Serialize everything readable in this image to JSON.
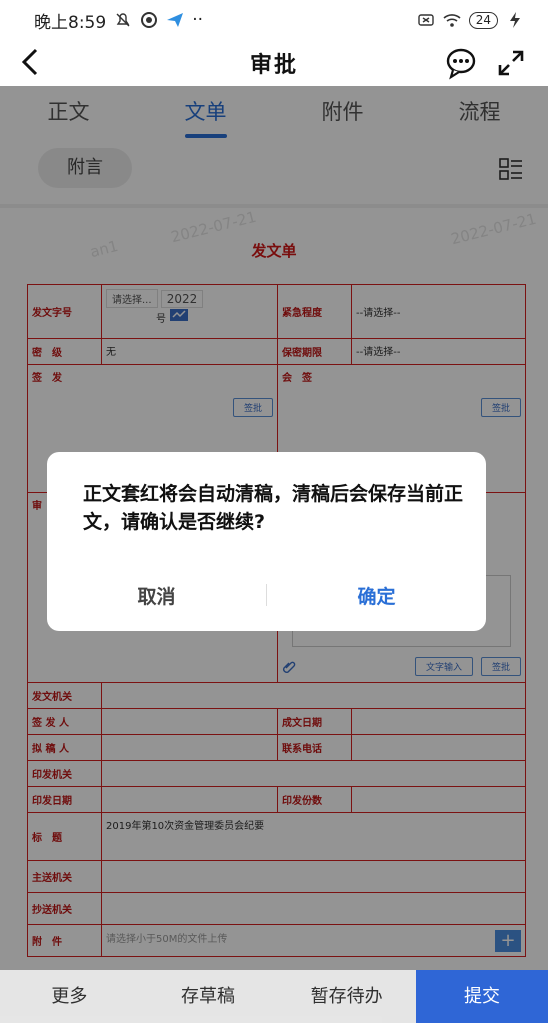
{
  "status_bar": {
    "time": "晚上8:59",
    "dots": "··",
    "battery": "24"
  },
  "header": {
    "title": "审批"
  },
  "tabs": [
    {
      "label": "正文"
    },
    {
      "label": "文单"
    },
    {
      "label": "附件"
    },
    {
      "label": "流程"
    }
  ],
  "sub": {
    "chip": "附言"
  },
  "doc": {
    "title": "发文单",
    "watermark_date": "2022-07-21",
    "watermark_mark": "an1",
    "fields": {
      "doc_no_label": "发文字号",
      "doc_no_select": "请选择...",
      "doc_no_year": "2022",
      "doc_no_suffix": "号",
      "urgency_label": "紧急程度",
      "urgency_value": "--请选择--",
      "secret_label": "密　级",
      "secret_value": "无",
      "secret_period_label": "保密期限",
      "secret_period_value": "--请选择--",
      "sign_label": "签　发",
      "countersign_label": "会　签",
      "sign_btn": "签批",
      "countersign_btn": "签批",
      "review_label": "审",
      "text_input_btn": "文字输入",
      "review_sign_btn": "签批",
      "issuing_org_label": "发文机关",
      "signer_label": "签 发 人",
      "created_date_label": "成文日期",
      "drafter_label": "拟 稿 人",
      "phone_label": "联系电话",
      "print_org_label": "印发机关",
      "print_date_label": "印发日期",
      "print_copies_label": "印发份数",
      "subject_label": "标　题",
      "subject_value": "2019年第10次资金管理委员会纪要",
      "main_to_label": "主送机关",
      "cc_to_label": "抄送机关",
      "attach_label": "附　件",
      "attach_placeholder": "请选择小于50M的文件上传",
      "attach_plus": "+"
    }
  },
  "dialog": {
    "message": "正文套红将会自动清稿，清稿后会保存当前正文，请确认是否继续?",
    "cancel": "取消",
    "confirm": "确定"
  },
  "bottom": {
    "more": "更多",
    "draft": "存草稿",
    "pending": "暂存待办",
    "submit": "提交"
  },
  "colors": {
    "accent": "#2a6fd6",
    "form_red": "#d42020",
    "submit_bg": "#2f66d6"
  },
  "icons": [
    "back-arrow-icon",
    "chat-bubble-icon",
    "expand-icon",
    "list-view-icon",
    "signature-icon",
    "attachment-clip-icon"
  ]
}
